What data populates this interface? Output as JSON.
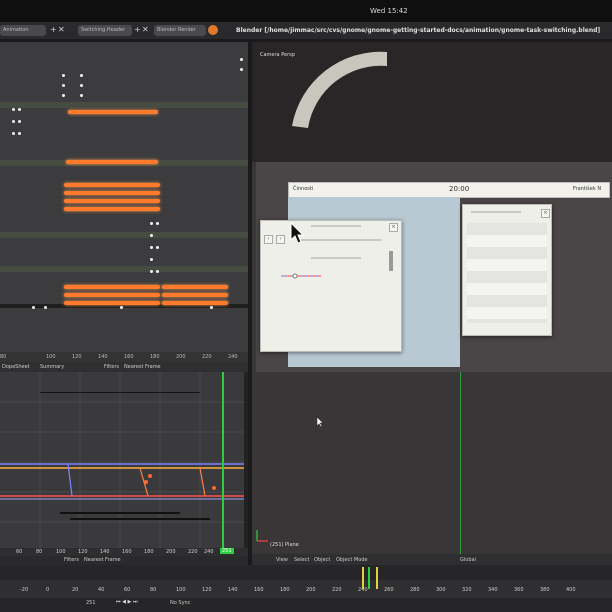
{
  "topbar": {
    "clock": "Wed 15:42"
  },
  "titlebar": {
    "title": "Blender [/home/jimmac/src/cvs/gnome/gnome-getting-started-docs/animation/gnome-task-switching.blend]",
    "menus": [
      "Animation",
      "Switching.Header",
      "Blender Render"
    ],
    "close_symbol": "✕",
    "add_symbol": "+",
    "icon": "blender-logo-icon"
  },
  "dopesheet": {
    "ruler_ticks": [
      "80",
      "100",
      "120",
      "140",
      "160",
      "180",
      "200",
      "220",
      "240"
    ],
    "header": {
      "mode": "DopeSheet",
      "summary": "Summary",
      "filters": "Filters",
      "nearest": "Nearest Frame"
    }
  },
  "graph": {
    "ruler_ticks": [
      "60",
      "80",
      "100",
      "120",
      "140",
      "160",
      "180",
      "200",
      "220",
      "240"
    ],
    "current_frame": "251",
    "header": {
      "filters": "Filters",
      "nearest": "Nearest Frame"
    }
  },
  "viewport": {
    "camera_label": "Camera Persp",
    "object_label": "(251) Plane",
    "header": {
      "view": "View",
      "select": "Select",
      "object": "Object",
      "mode": "Object Mode",
      "orientation": "Global"
    },
    "gnome": {
      "activities": "Činnosti",
      "time": "20:00",
      "user": "František N"
    }
  },
  "timeline": {
    "ticks": [
      "-20",
      "0",
      "20",
      "40",
      "60",
      "80",
      "100",
      "120",
      "140",
      "160",
      "180",
      "200",
      "220",
      "240",
      "260",
      "280",
      "300",
      "320",
      "340",
      "360",
      "380",
      "400"
    ],
    "frame": "251",
    "sync": "No Sync"
  },
  "colors": {
    "keyframe": "#ff7a2a",
    "current_frame": "#2ecc40",
    "window_bg": "#efefea"
  }
}
